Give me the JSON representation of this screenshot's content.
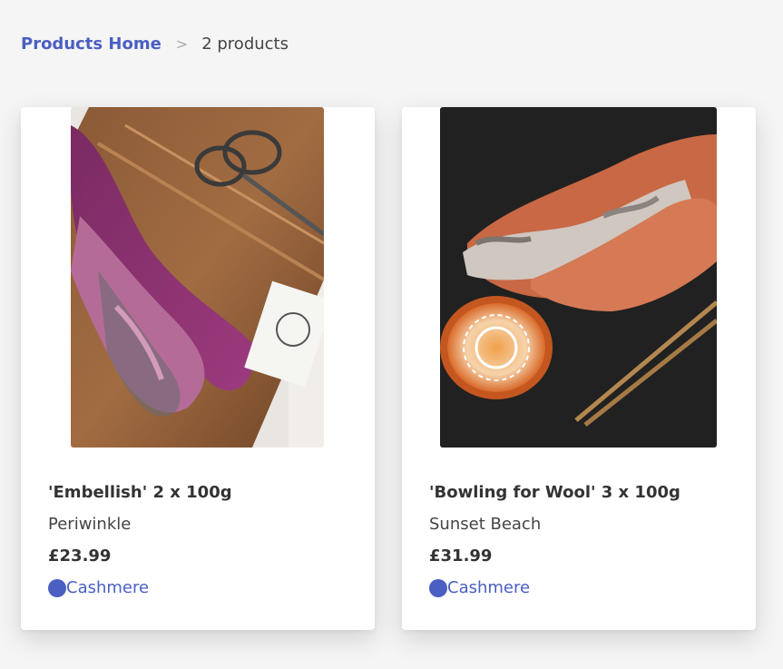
{
  "breadcrumb": {
    "home_label": "Products Home",
    "separator": ">",
    "current": "2 products"
  },
  "products": [
    {
      "title": "'Embellish' 2 x 100g",
      "variant": "Periwinkle",
      "price": "£23.99",
      "tag": "Cashmere",
      "image": "purple-and-pink-yarn-skeins-with-scissors-and-needles"
    },
    {
      "title": "'Bowling for Wool' 3 x 100g",
      "variant": "Sunset Beach",
      "price": "£31.99",
      "tag": "Cashmere",
      "image": "orange-and-grey-yarn-skeins-with-mandala-bowl-and-needles"
    }
  ],
  "colors": {
    "accent": "#4a5fc1",
    "background": "#f5f5f5",
    "card": "#ffffff"
  }
}
